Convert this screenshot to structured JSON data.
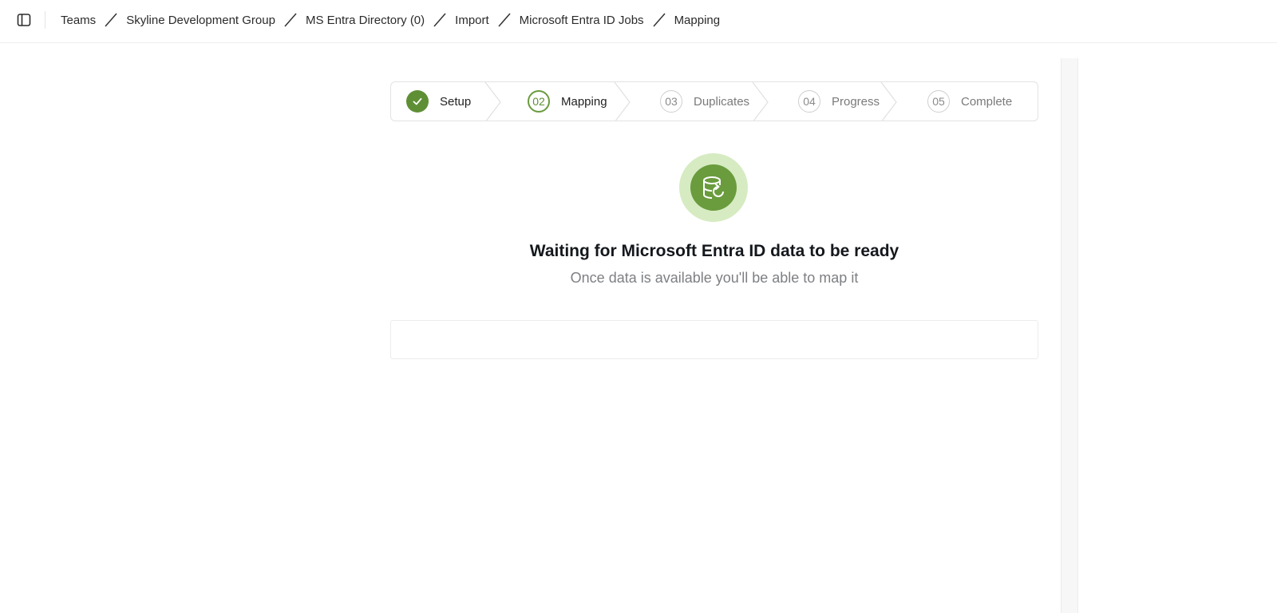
{
  "breadcrumb": {
    "items": [
      "Teams",
      "Skyline Development Group",
      "MS Entra Directory (0)",
      "Import",
      "Microsoft Entra ID Jobs",
      "Mapping"
    ]
  },
  "stepper": {
    "steps": [
      {
        "number": "",
        "label": "Setup",
        "state": "done"
      },
      {
        "number": "02",
        "label": "Mapping",
        "state": "active"
      },
      {
        "number": "03",
        "label": "Duplicates",
        "state": "todo"
      },
      {
        "number": "04",
        "label": "Progress",
        "state": "todo"
      },
      {
        "number": "05",
        "label": "Complete",
        "state": "todo"
      }
    ]
  },
  "status": {
    "icon": "database-sync-icon",
    "title": "Waiting for Microsoft Entra ID data to be ready",
    "subtitle": "Once data is available you'll be able to map it"
  },
  "colors": {
    "accent": "#6a9b3d",
    "accent_light": "#d6ebc2"
  }
}
